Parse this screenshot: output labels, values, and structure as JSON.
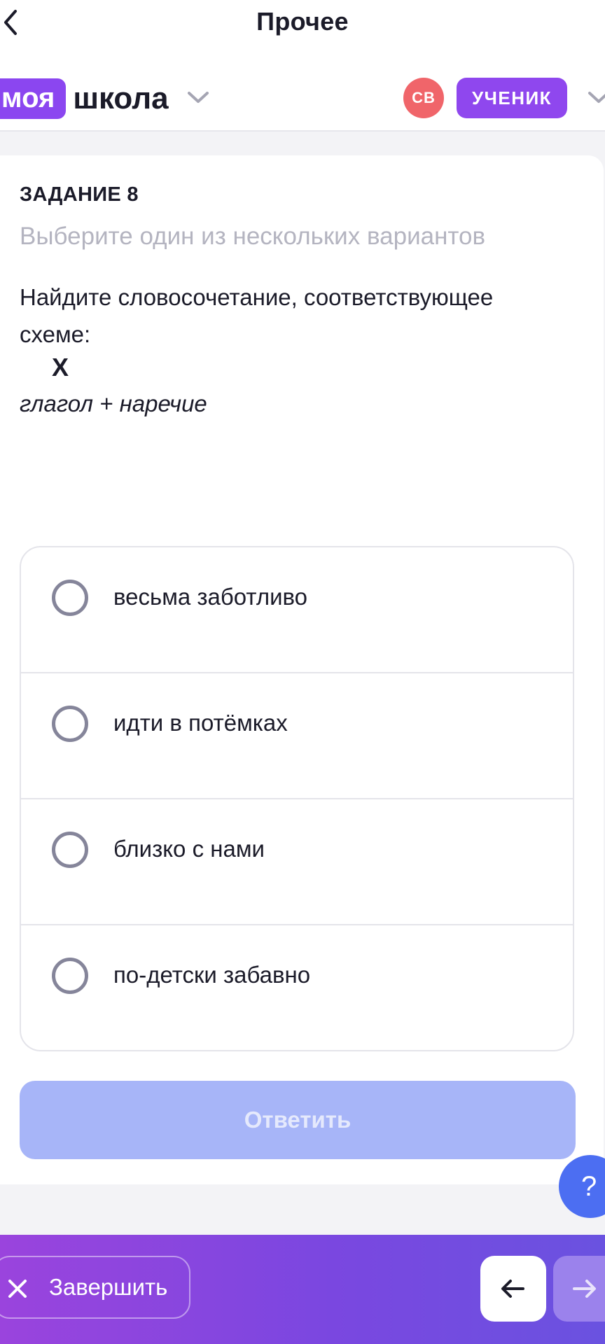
{
  "header": {
    "title": "Прочее",
    "back_icon": "chevron-left-icon",
    "logo_part1": "моя",
    "logo_part2": "школа",
    "avatar_initials": "СВ",
    "role": "УЧЕНИК"
  },
  "task": {
    "number_label": "ЗАДАНИЕ 8",
    "hint": "Выберите один из нескольких вариантов",
    "question": "Найдите словосочетание, соответствующее схеме:",
    "marker": "X",
    "scheme": "глагол + наречие"
  },
  "options": [
    {
      "label": "весьма заботливо",
      "selected": false
    },
    {
      "label": "идти в потёмках",
      "selected": false
    },
    {
      "label": "близко с нами",
      "selected": false
    },
    {
      "label": "по-детски забавно",
      "selected": false
    }
  ],
  "answer_button": {
    "label": "Ответить",
    "enabled": false
  },
  "help_button": {
    "label": "?"
  },
  "footer": {
    "finish_label": "Завершить",
    "prev_icon": "arrow-left-icon",
    "next_icon": "arrow-right-icon"
  },
  "colors": {
    "accent_purple": "#8b46f0",
    "avatar_red": "#f0656a",
    "button_disabled": "#a7b5f8",
    "help_blue": "#4c6ef2"
  }
}
